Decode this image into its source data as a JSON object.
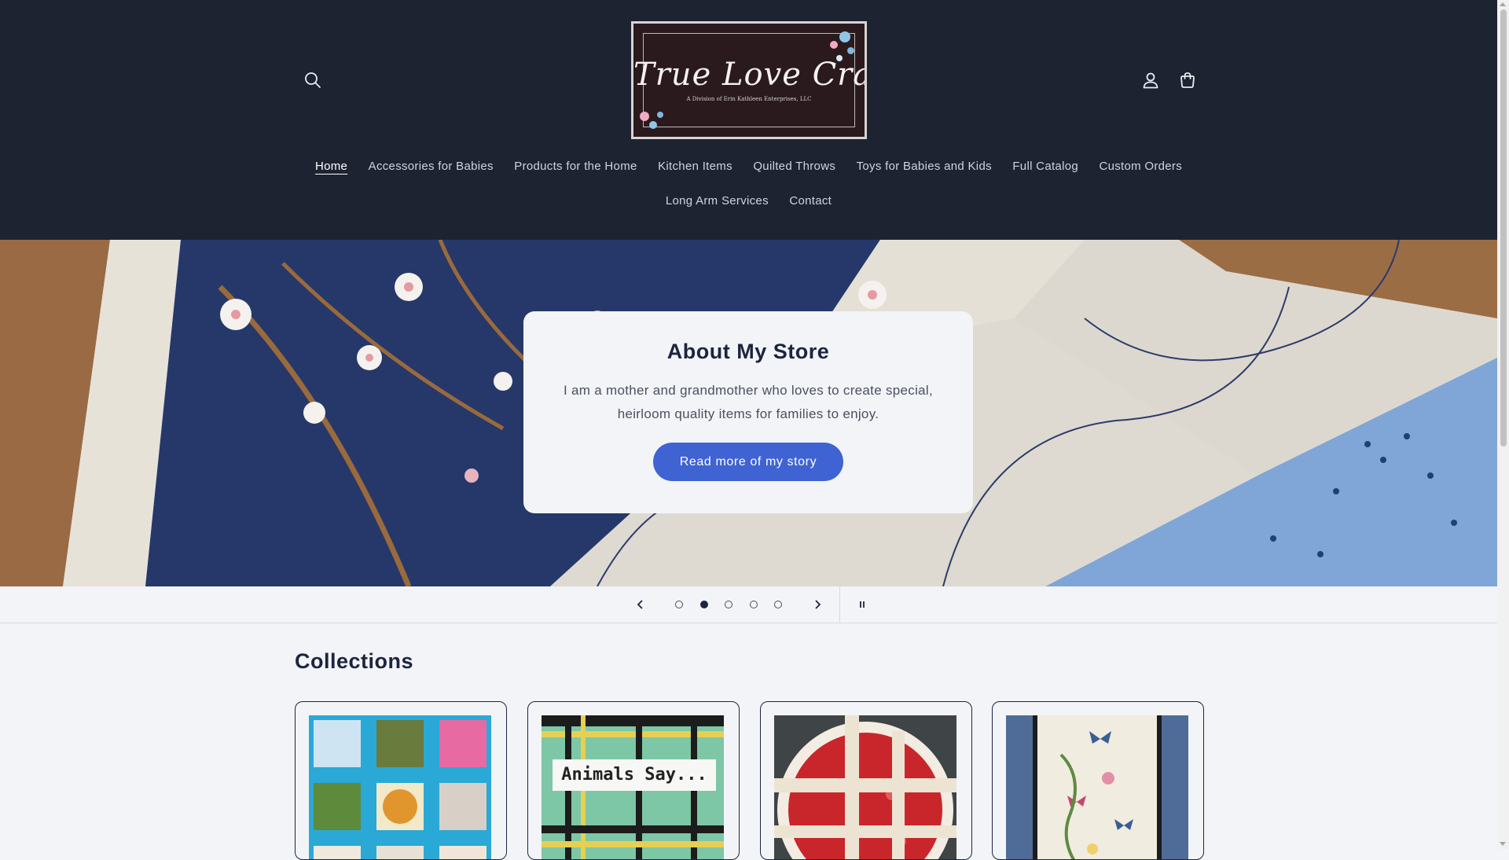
{
  "header": {
    "logo": {
      "title": "True Love Crafts",
      "subtitle": "A Division of Erin Kathleen Enterprises, LLC"
    },
    "icons": {
      "search": "search-icon",
      "account": "account-icon",
      "cart": "cart-icon"
    }
  },
  "nav": {
    "items": [
      {
        "label": "Home",
        "active": true
      },
      {
        "label": "Accessories for Babies"
      },
      {
        "label": "Products for the Home"
      },
      {
        "label": "Kitchen Items"
      },
      {
        "label": "Quilted Throws"
      },
      {
        "label": "Toys for Babies and Kids"
      },
      {
        "label": "Full Catalog"
      },
      {
        "label": "Custom Orders"
      },
      {
        "label": "Long Arm Services"
      },
      {
        "label": "Contact"
      }
    ]
  },
  "hero": {
    "title": "About My Store",
    "text": "I am a mother and grandmother who loves to create special, heirloom quality items for families to enjoy.",
    "button": "Read more of my story"
  },
  "slider": {
    "slides": 5,
    "active_slide": 2,
    "icons": {
      "prev": "chevron-left-icon",
      "next": "chevron-right-icon",
      "pause": "pause-icon"
    }
  },
  "collections": {
    "title": "Collections",
    "cards": [
      {
        "name": "baby-quilt"
      },
      {
        "name": "animals-say-book",
        "image_text": "Animals Say..."
      },
      {
        "name": "cherry-pie-potholder"
      },
      {
        "name": "butterfly-table-runner"
      }
    ]
  },
  "colors": {
    "header_bg": "#1e2332",
    "page_bg": "#f2f4f7",
    "button": "#3f63d3",
    "heading": "#1d2440"
  }
}
